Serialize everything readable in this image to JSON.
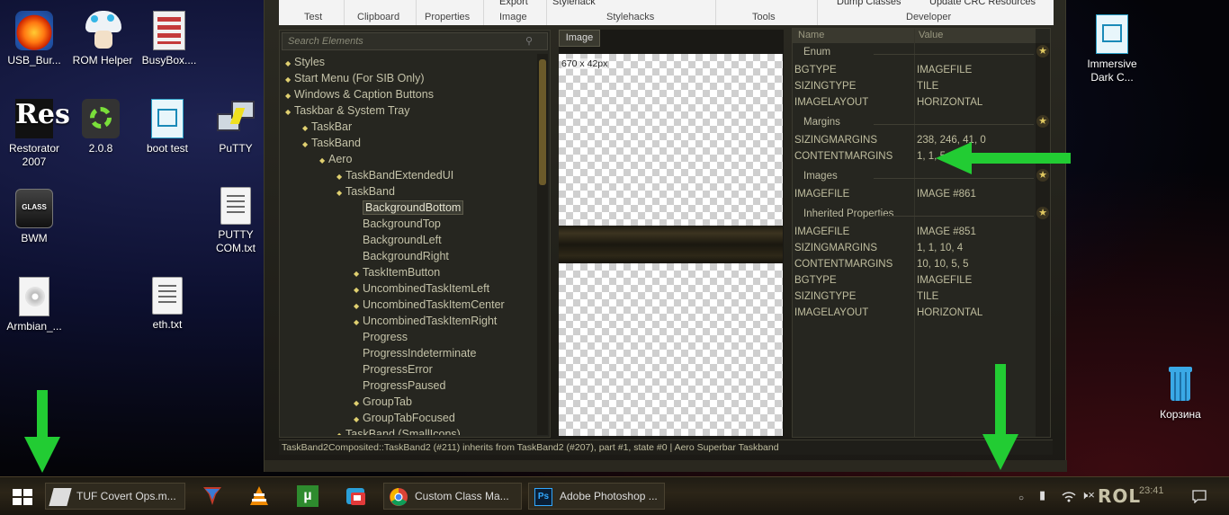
{
  "ribbon": {
    "top_items": [
      "Export",
      "Stylehack",
      "Dump Classes",
      "Update CRC Resources"
    ],
    "groups": [
      "Test",
      "Clipboard",
      "Properties",
      "Image",
      "Stylehacks",
      "Tools",
      "Developer"
    ]
  },
  "search": {
    "placeholder": "Search Elements"
  },
  "tree": [
    "Styles",
    "Start Menu (For SIB Only)",
    "Windows & Caption Buttons",
    "Taskbar & System Tray",
    "TaskBar",
    "TaskBand",
    "Aero",
    "TaskBandExtendedUI",
    "TaskBand",
    "BackgroundBottom",
    "BackgroundTop",
    "BackgroundLeft",
    "BackgroundRight",
    "TaskItemButton",
    "UncombinedTaskItemLeft",
    "UncombinedTaskItemCenter",
    "UncombinedTaskItemRight",
    "Progress",
    "ProgressIndeterminate",
    "ProgressError",
    "ProgressPaused",
    "GroupTab",
    "GroupTabFocused",
    "TaskBand (SmallIcons)"
  ],
  "image_panel": {
    "tab": "Image",
    "dimensions": "670 x 42px"
  },
  "properties": {
    "col_name": "Name",
    "col_value": "Value",
    "groups": {
      "enum": "Enum",
      "margins": "Margins",
      "images": "Images",
      "inherited": "Inherited Properties"
    },
    "enum_rows": [
      {
        "name": "BGTYPE",
        "value": "IMAGEFILE"
      },
      {
        "name": "SIZINGTYPE",
        "value": "TILE"
      },
      {
        "name": "IMAGELAYOUT",
        "value": "HORIZONTAL"
      }
    ],
    "margins_rows": [
      {
        "name": "SIZINGMARGINS",
        "value": "238, 246, 41, 0"
      },
      {
        "name": "CONTENTMARGINS",
        "value": "1, 1, 5"
      }
    ],
    "images_rows": [
      {
        "name": "IMAGEFILE",
        "value": "IMAGE #861"
      }
    ],
    "inherited_rows": [
      {
        "name": "IMAGEFILE",
        "value": "IMAGE #851"
      },
      {
        "name": "SIZINGMARGINS",
        "value": "1, 1, 10, 4"
      },
      {
        "name": "CONTENTMARGINS",
        "value": "10, 10, 5, 5"
      },
      {
        "name": "BGTYPE",
        "value": "IMAGEFILE"
      },
      {
        "name": "SIZINGTYPE",
        "value": "TILE"
      },
      {
        "name": "IMAGELAYOUT",
        "value": "HORIZONTAL"
      }
    ]
  },
  "status": "TaskBand2Composited::TaskBand2 (#211) inherits from TaskBand2 (#207),  part #1,  state #0  |  Aero Superbar Taskband",
  "desktop_icons": [
    {
      "label": "USB_Bur...",
      "icon": "usb-burner-icon"
    },
    {
      "label": "ROM Helper",
      "icon": "mushroom-icon"
    },
    {
      "label": "BusyBox....",
      "icon": "archive-icon"
    },
    {
      "label": "Restorator 2007",
      "icon": "restorator-icon"
    },
    {
      "label": "2.0.8",
      "icon": "gear-icon"
    },
    {
      "label": "boot test",
      "icon": "file-icon"
    },
    {
      "label": "PuTTY",
      "icon": "putty-icon"
    },
    {
      "label": "BWM",
      "icon": "glass-icon"
    },
    {
      "label": "PUTTY COM.txt",
      "icon": "text-file-icon"
    },
    {
      "label": "Armbian_...",
      "icon": "disc-image-icon"
    },
    {
      "label": "eth.txt",
      "icon": "text-file-icon"
    },
    {
      "label": "Immersive Dark C...",
      "icon": "file-icon"
    },
    {
      "label": "Корзина",
      "icon": "recycle-bin-icon"
    }
  ],
  "taskbar": {
    "apps": [
      {
        "label": "TUF Covert Ops.m...",
        "icon": "file-icon"
      },
      {
        "label": "Custom Class Ma...",
        "icon": "chrome-icon"
      },
      {
        "label": "Adobe Photoshop ...",
        "icon": "photoshop-icon"
      }
    ],
    "clock": "23:41",
    "brand": "ROL"
  },
  "colors": {
    "accent_arrow": "#22cc33",
    "tree_text": "#c4c2a8",
    "bullet": "#e0d070"
  }
}
